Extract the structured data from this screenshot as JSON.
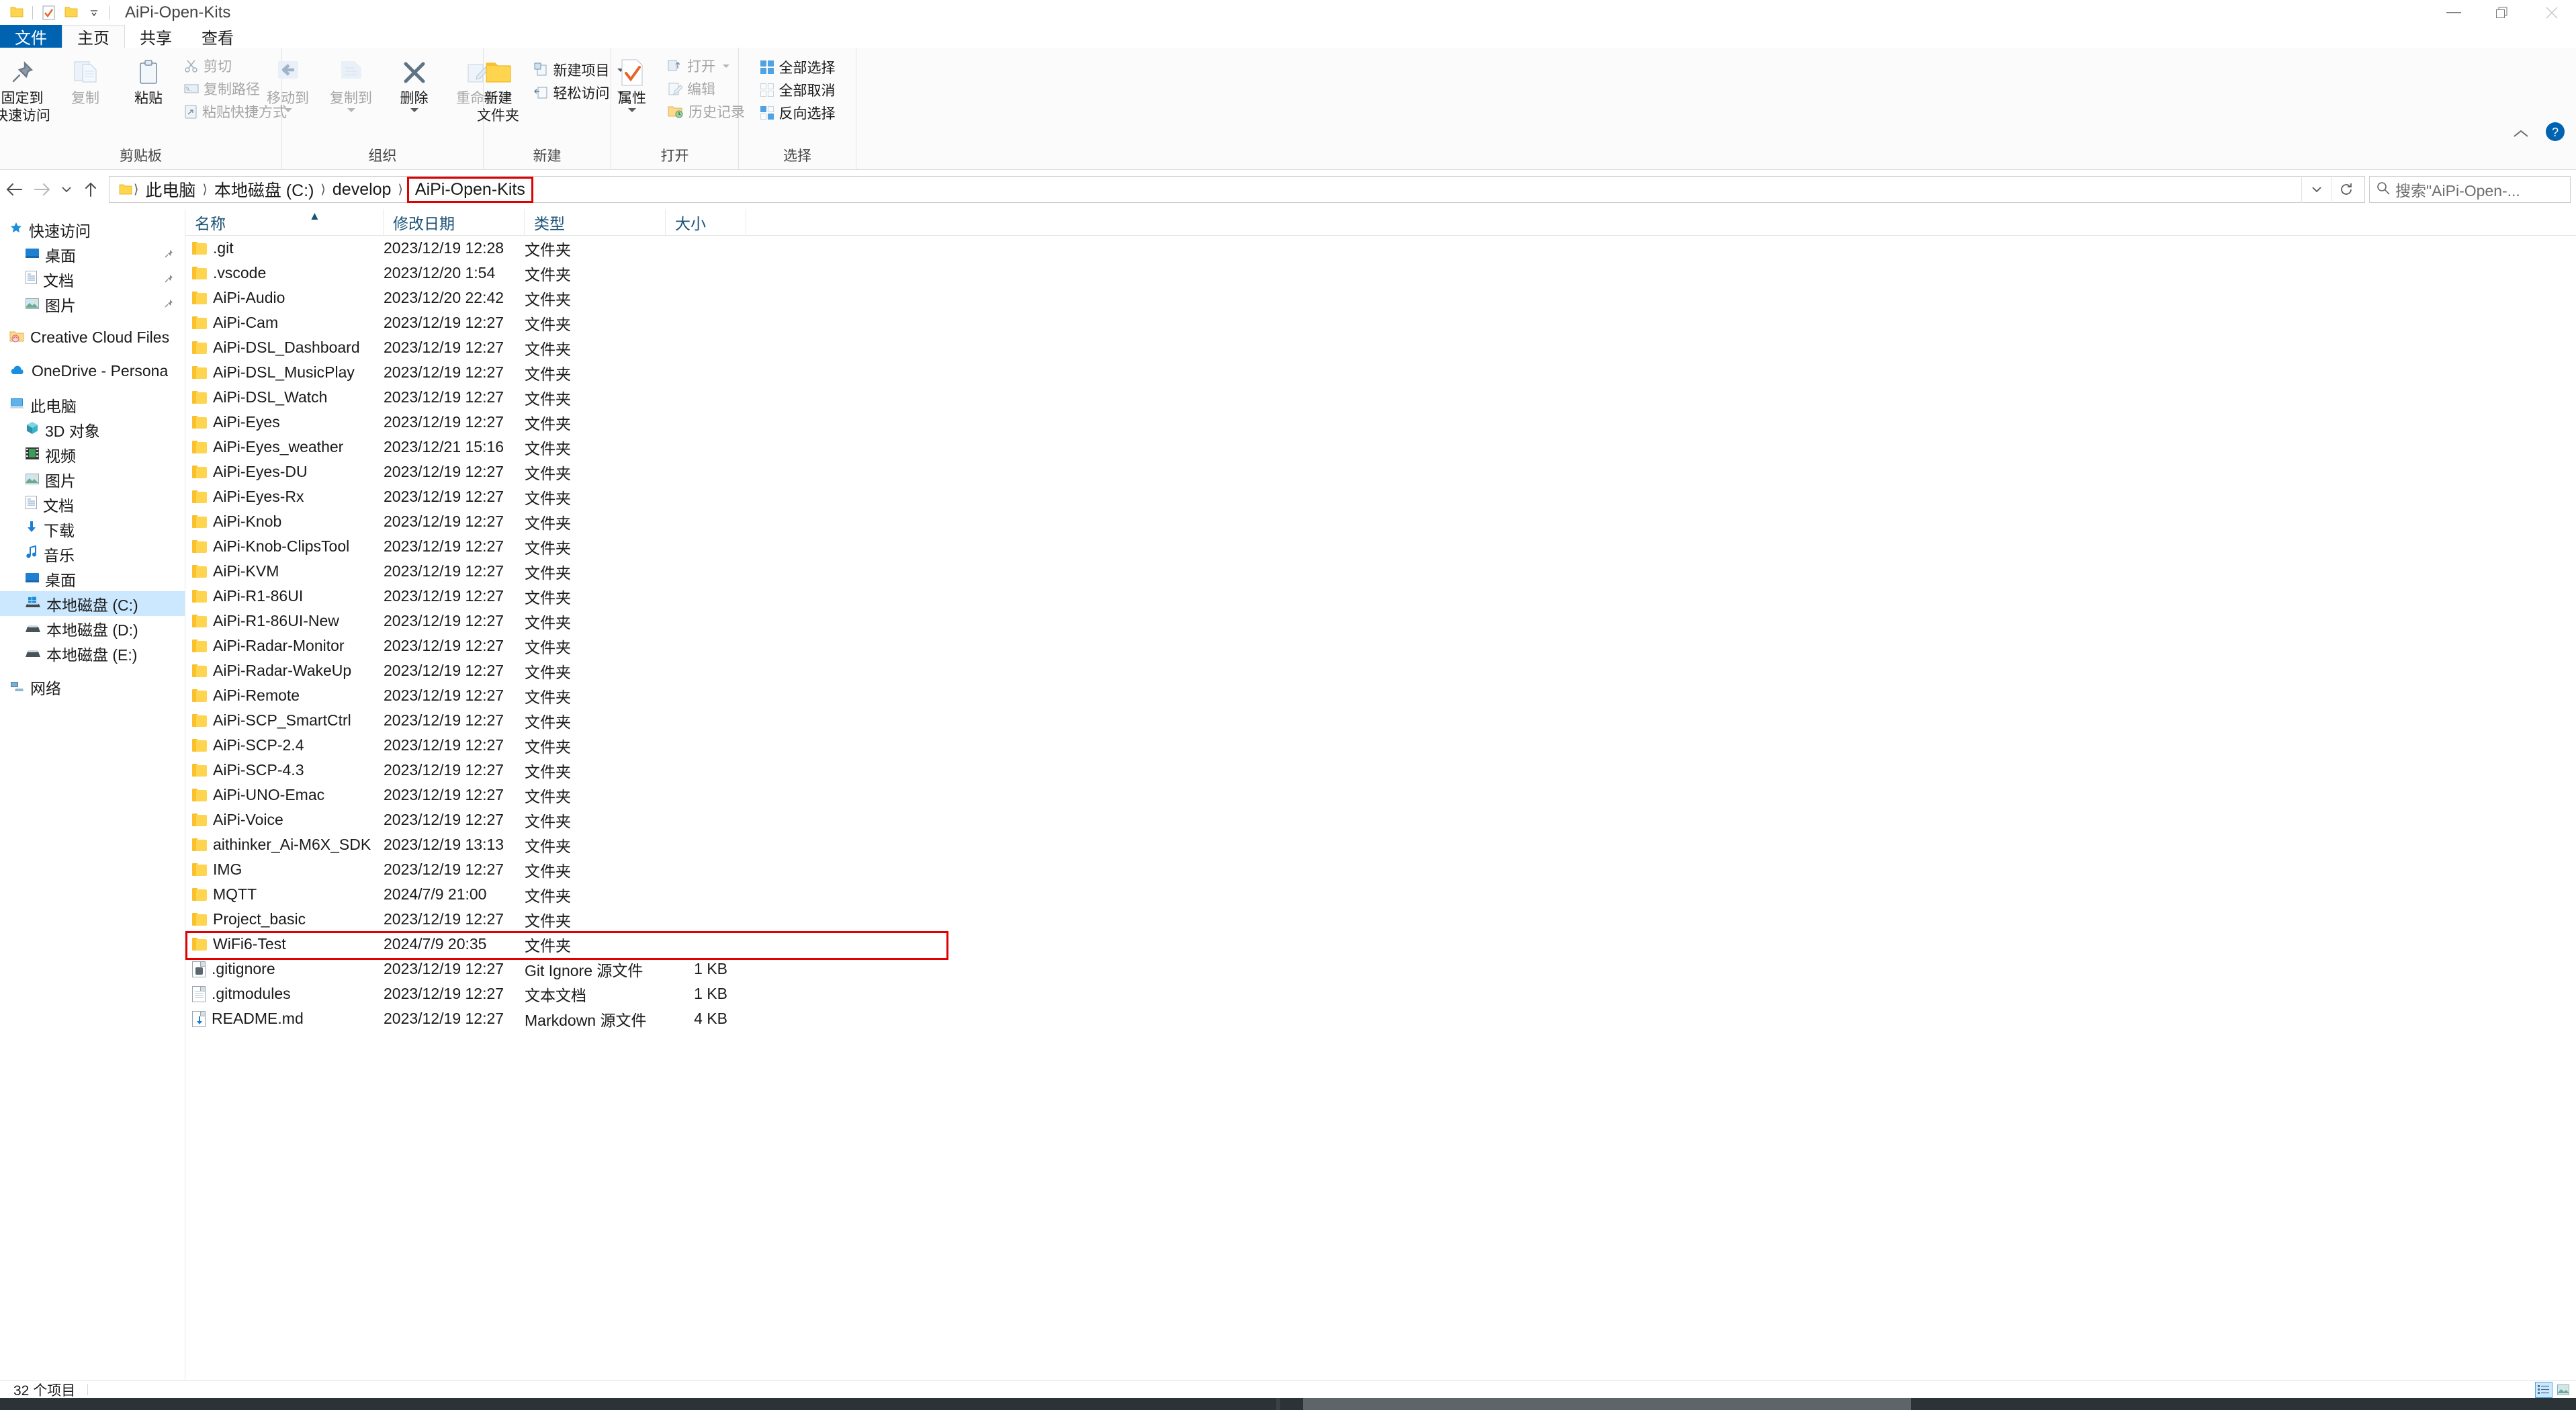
{
  "window": {
    "title": "AiPi-Open-Kits",
    "quick_access": [
      "folder-icon",
      "properties-icon",
      "new-folder-icon",
      "customize-dropdown-icon"
    ],
    "controls": {
      "minimize": "minimize-icon",
      "restore": "restore-icon",
      "close": "close-icon"
    },
    "ribbon_collapse": "chevron-up-icon",
    "help": "help-icon"
  },
  "tabs": [
    {
      "label": "文件",
      "kind": "file"
    },
    {
      "label": "主页",
      "kind": "active"
    },
    {
      "label": "共享",
      "kind": "normal"
    },
    {
      "label": "查看",
      "kind": "normal"
    }
  ],
  "ribbon": {
    "groups": [
      {
        "label": "剪贴板",
        "big_buttons": [
          {
            "label_line1": "固定到",
            "label_line2": "快速访问",
            "icon": "pin-icon",
            "dim": false
          },
          {
            "label_line1": "复制",
            "label_line2": "",
            "icon": "copy-icon",
            "dim": true
          },
          {
            "label_line1": "粘贴",
            "label_line2": "",
            "icon": "paste-icon",
            "dim": false
          }
        ],
        "small_buttons": [
          {
            "label": "剪切",
            "icon": "scissors-icon",
            "dim": true,
            "caret": false
          },
          {
            "label": "复制路径",
            "icon": "copy-path-icon",
            "dim": true,
            "caret": false
          },
          {
            "label": "粘贴快捷方式",
            "icon": "paste-shortcut-icon",
            "dim": true,
            "caret": false
          }
        ]
      },
      {
        "label": "组织",
        "big_buttons": [
          {
            "label_line1": "移动到",
            "label_line2": "",
            "icon": "move-to-icon",
            "dim": true,
            "caret": true
          },
          {
            "label_line1": "复制到",
            "label_line2": "",
            "icon": "copy-to-icon",
            "dim": true,
            "caret": true
          },
          {
            "label_line1": "删除",
            "label_line2": "",
            "icon": "delete-icon",
            "dim": false,
            "caret": true
          },
          {
            "label_line1": "重命名",
            "label_line2": "",
            "icon": "rename-icon",
            "dim": true,
            "caret": false
          }
        ],
        "small_buttons": []
      },
      {
        "label": "新建",
        "big_buttons": [
          {
            "label_line1": "新建",
            "label_line2": "文件夹",
            "icon": "new-folder-icon",
            "dim": false
          }
        ],
        "small_buttons": [
          {
            "label": "新建项目",
            "icon": "new-item-icon",
            "dim": false,
            "caret": true
          },
          {
            "label": "轻松访问",
            "icon": "easy-access-icon",
            "dim": false,
            "caret": true
          }
        ]
      },
      {
        "label": "打开",
        "big_buttons": [
          {
            "label_line1": "属性",
            "label_line2": "",
            "icon": "properties-icon",
            "dim": false,
            "caret": true
          }
        ],
        "small_buttons": [
          {
            "label": "打开",
            "icon": "open-icon",
            "dim": true,
            "caret": true
          },
          {
            "label": "编辑",
            "icon": "edit-icon",
            "dim": true,
            "caret": false
          },
          {
            "label": "历史记录",
            "icon": "history-icon",
            "dim": true,
            "caret": false
          }
        ]
      },
      {
        "label": "选择",
        "big_buttons": [],
        "small_buttons": [
          {
            "label": "全部选择",
            "icon": "select-all-icon",
            "dim": false,
            "caret": false
          },
          {
            "label": "全部取消",
            "icon": "select-none-icon",
            "dim": false,
            "caret": false
          },
          {
            "label": "反向选择",
            "icon": "invert-selection-icon",
            "dim": false,
            "caret": false
          }
        ]
      }
    ]
  },
  "address": {
    "back": "back-arrow-icon",
    "forward": "forward-arrow-icon",
    "recent": "chevron-down-icon",
    "up": "up-arrow-icon",
    "folder_icon": "folder-icon",
    "crumbs": [
      "此电脑",
      "本地磁盘 (C:)",
      "develop",
      "AiPi-Open-Kits"
    ],
    "highlighted_crumb_index": 3,
    "dropdown_icon": "chevron-down-icon",
    "refresh_icon": "refresh-icon"
  },
  "search": {
    "icon": "search-icon",
    "placeholder": "搜索\"AiPi-Open-..."
  },
  "sidebar": {
    "groups": [
      {
        "header": {
          "label": "快速访问",
          "icon": "star-pin-icon",
          "level": 0
        },
        "items": [
          {
            "label": "桌面",
            "icon": "desktop-icon",
            "level": 1,
            "pinned": true
          },
          {
            "label": "文档",
            "icon": "documents-icon",
            "level": 1,
            "pinned": true
          },
          {
            "label": "图片",
            "icon": "pictures-icon",
            "level": 1,
            "pinned": true
          }
        ]
      },
      {
        "header": {
          "label": "Creative Cloud Files",
          "icon": "creative-cloud-icon",
          "level": 0
        },
        "items": []
      },
      {
        "header": {
          "label": "OneDrive - Persona",
          "icon": "onedrive-icon",
          "level": 0
        },
        "items": []
      },
      {
        "header": {
          "label": "此电脑",
          "icon": "this-pc-icon",
          "level": 0
        },
        "items": [
          {
            "label": "3D 对象",
            "icon": "3d-objects-icon",
            "level": 1,
            "pinned": false
          },
          {
            "label": "视频",
            "icon": "videos-icon",
            "level": 1,
            "pinned": false
          },
          {
            "label": "图片",
            "icon": "pictures-icon",
            "level": 1,
            "pinned": false
          },
          {
            "label": "文档",
            "icon": "documents-icon",
            "level": 1,
            "pinned": false
          },
          {
            "label": "下载",
            "icon": "downloads-icon",
            "level": 1,
            "pinned": false
          },
          {
            "label": "音乐",
            "icon": "music-icon",
            "level": 1,
            "pinned": false
          },
          {
            "label": "桌面",
            "icon": "desktop-icon",
            "level": 1,
            "pinned": false
          },
          {
            "label": "本地磁盘 (C:)",
            "icon": "windows-drive-icon",
            "level": 1,
            "pinned": false,
            "selected": true
          },
          {
            "label": "本地磁盘 (D:)",
            "icon": "drive-icon",
            "level": 1,
            "pinned": false
          },
          {
            "label": "本地磁盘 (E:)",
            "icon": "drive-icon",
            "level": 1,
            "pinned": false
          }
        ]
      },
      {
        "header": {
          "label": "网络",
          "icon": "network-icon",
          "level": 0
        },
        "items": []
      }
    ]
  },
  "filelist": {
    "columns": [
      "名称",
      "修改日期",
      "类型",
      "大小"
    ],
    "sorted_column": 0,
    "sort_direction": "ascending",
    "rows": [
      {
        "name": ".git",
        "date": "2023/12/19 12:28",
        "type": "文件夹",
        "size": "",
        "icon": "folder-icon"
      },
      {
        "name": ".vscode",
        "date": "2023/12/20 1:54",
        "type": "文件夹",
        "size": "",
        "icon": "folder-icon"
      },
      {
        "name": "AiPi-Audio",
        "date": "2023/12/20 22:42",
        "type": "文件夹",
        "size": "",
        "icon": "folder-icon"
      },
      {
        "name": "AiPi-Cam",
        "date": "2023/12/19 12:27",
        "type": "文件夹",
        "size": "",
        "icon": "folder-icon"
      },
      {
        "name": "AiPi-DSL_Dashboard",
        "date": "2023/12/19 12:27",
        "type": "文件夹",
        "size": "",
        "icon": "folder-icon"
      },
      {
        "name": "AiPi-DSL_MusicPlay",
        "date": "2023/12/19 12:27",
        "type": "文件夹",
        "size": "",
        "icon": "folder-icon"
      },
      {
        "name": "AiPi-DSL_Watch",
        "date": "2023/12/19 12:27",
        "type": "文件夹",
        "size": "",
        "icon": "folder-icon"
      },
      {
        "name": "AiPi-Eyes",
        "date": "2023/12/19 12:27",
        "type": "文件夹",
        "size": "",
        "icon": "folder-icon"
      },
      {
        "name": "AiPi-Eyes_weather",
        "date": "2023/12/21 15:16",
        "type": "文件夹",
        "size": "",
        "icon": "folder-icon"
      },
      {
        "name": "AiPi-Eyes-DU",
        "date": "2023/12/19 12:27",
        "type": "文件夹",
        "size": "",
        "icon": "folder-icon"
      },
      {
        "name": "AiPi-Eyes-Rx",
        "date": "2023/12/19 12:27",
        "type": "文件夹",
        "size": "",
        "icon": "folder-icon"
      },
      {
        "name": "AiPi-Knob",
        "date": "2023/12/19 12:27",
        "type": "文件夹",
        "size": "",
        "icon": "folder-icon"
      },
      {
        "name": "AiPi-Knob-ClipsTool",
        "date": "2023/12/19 12:27",
        "type": "文件夹",
        "size": "",
        "icon": "folder-icon"
      },
      {
        "name": "AiPi-KVM",
        "date": "2023/12/19 12:27",
        "type": "文件夹",
        "size": "",
        "icon": "folder-icon"
      },
      {
        "name": "AiPi-R1-86UI",
        "date": "2023/12/19 12:27",
        "type": "文件夹",
        "size": "",
        "icon": "folder-icon"
      },
      {
        "name": "AiPi-R1-86UI-New",
        "date": "2023/12/19 12:27",
        "type": "文件夹",
        "size": "",
        "icon": "folder-icon"
      },
      {
        "name": "AiPi-Radar-Monitor",
        "date": "2023/12/19 12:27",
        "type": "文件夹",
        "size": "",
        "icon": "folder-icon"
      },
      {
        "name": "AiPi-Radar-WakeUp",
        "date": "2023/12/19 12:27",
        "type": "文件夹",
        "size": "",
        "icon": "folder-icon"
      },
      {
        "name": "AiPi-Remote",
        "date": "2023/12/19 12:27",
        "type": "文件夹",
        "size": "",
        "icon": "folder-icon"
      },
      {
        "name": "AiPi-SCP_SmartCtrl",
        "date": "2023/12/19 12:27",
        "type": "文件夹",
        "size": "",
        "icon": "folder-icon"
      },
      {
        "name": "AiPi-SCP-2.4",
        "date": "2023/12/19 12:27",
        "type": "文件夹",
        "size": "",
        "icon": "folder-icon"
      },
      {
        "name": "AiPi-SCP-4.3",
        "date": "2023/12/19 12:27",
        "type": "文件夹",
        "size": "",
        "icon": "folder-icon"
      },
      {
        "name": "AiPi-UNO-Emac",
        "date": "2023/12/19 12:27",
        "type": "文件夹",
        "size": "",
        "icon": "folder-icon"
      },
      {
        "name": "AiPi-Voice",
        "date": "2023/12/19 12:27",
        "type": "文件夹",
        "size": "",
        "icon": "folder-icon"
      },
      {
        "name": "aithinker_Ai-M6X_SDK",
        "date": "2023/12/19 13:13",
        "type": "文件夹",
        "size": "",
        "icon": "folder-icon"
      },
      {
        "name": "IMG",
        "date": "2023/12/19 12:27",
        "type": "文件夹",
        "size": "",
        "icon": "folder-icon"
      },
      {
        "name": "MQTT",
        "date": "2024/7/9 21:00",
        "type": "文件夹",
        "size": "",
        "icon": "folder-icon"
      },
      {
        "name": "Project_basic",
        "date": "2023/12/19 12:27",
        "type": "文件夹",
        "size": "",
        "icon": "folder-icon"
      },
      {
        "name": "WiFi6-Test",
        "date": "2024/7/9 20:35",
        "type": "文件夹",
        "size": "",
        "icon": "folder-icon",
        "marked": true
      },
      {
        "name": ".gitignore",
        "date": "2023/12/19 12:27",
        "type": "Git Ignore 源文件",
        "size": "1 KB",
        "icon": "gitignore-file-icon"
      },
      {
        "name": ".gitmodules",
        "date": "2023/12/19 12:27",
        "type": "文本文档",
        "size": "1 KB",
        "icon": "text-file-icon"
      },
      {
        "name": "README.md",
        "date": "2023/12/19 12:27",
        "type": "Markdown 源文件",
        "size": "4 KB",
        "icon": "markdown-file-icon"
      }
    ]
  },
  "statusbar": {
    "item_count": "32 个项目",
    "view_details_icon": "details-view-icon",
    "view_thumbnails_icon": "thumbnails-view-icon",
    "active_view": "details"
  },
  "colors": {
    "accent": "#0063b1",
    "highlight_box": "#e00000",
    "selection": "#cce8ff",
    "folder": "#ffd44f",
    "column_header_text": "#1a5276"
  }
}
